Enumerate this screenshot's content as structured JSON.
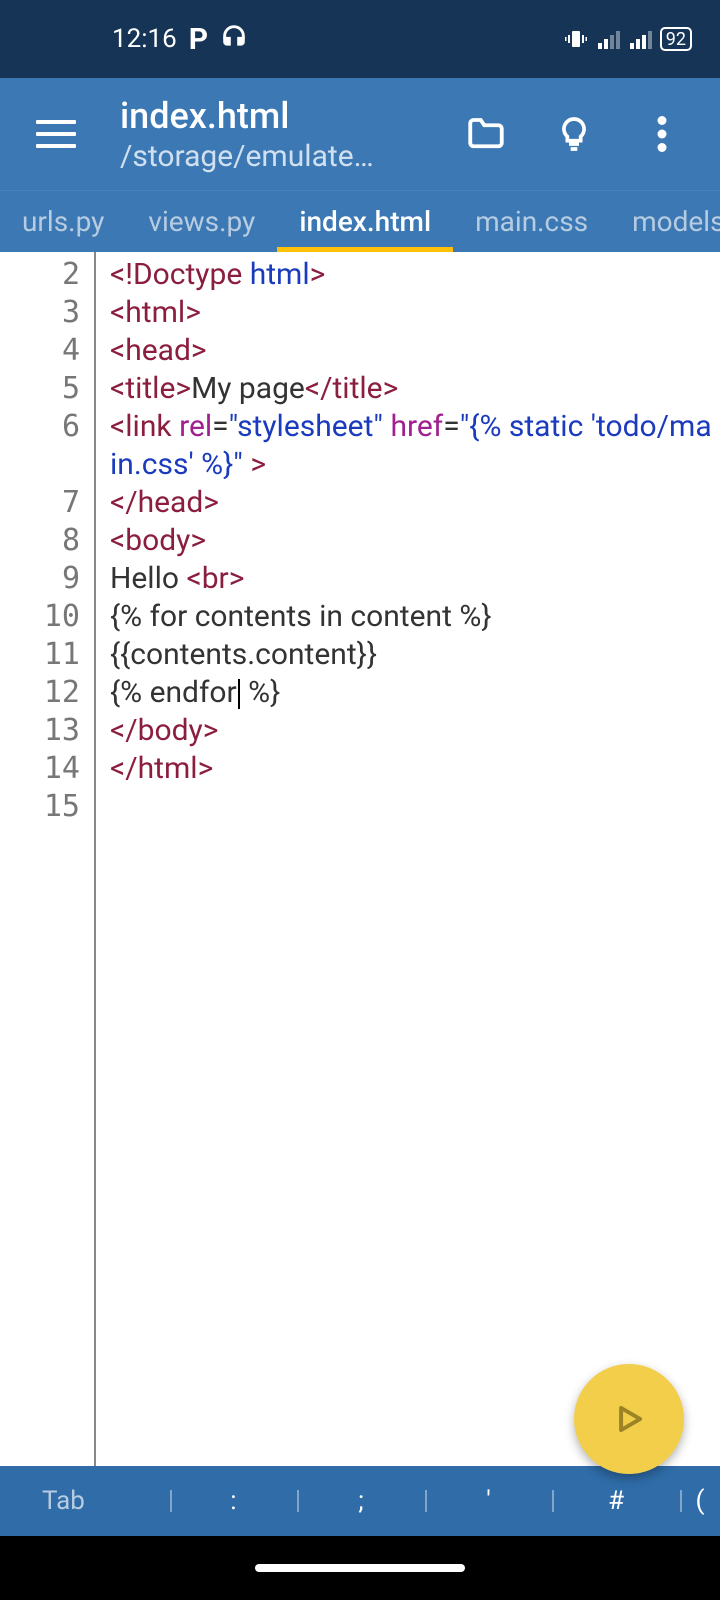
{
  "status": {
    "time": "12:16",
    "battery": "92"
  },
  "header": {
    "title": "index.html",
    "path": "/storage/emulate…"
  },
  "tabs": [
    {
      "label": "urls.py",
      "active": false
    },
    {
      "label": "views.py",
      "active": false
    },
    {
      "label": "index.html",
      "active": true
    },
    {
      "label": "main.css",
      "active": false
    },
    {
      "label": "models.py",
      "active": false
    }
  ],
  "lineNumbers": [
    "2",
    "3",
    "4",
    "5",
    "6",
    "7",
    "8",
    "9",
    "10",
    "11",
    "12",
    "13",
    "14",
    "15"
  ],
  "code": {
    "l2": {
      "a": "<!Doctype ",
      "b": "html",
      "c": ">"
    },
    "l3": {
      "a": "<html>"
    },
    "l4": {
      "a": "<head>"
    },
    "l5": {
      "a": "<title>",
      "b": "My page",
      "c": "</title>"
    },
    "l6": {
      "a": "<link ",
      "b": "rel",
      "c": "=",
      "d": "\"stylesheet\"",
      "e": " ",
      "f": "href",
      "g": "=",
      "h": "\"{% static 'todo/main.css' %}\"",
      "i": " >"
    },
    "l7": {
      "a": "</head>"
    },
    "l8": {
      "a": "<body>"
    },
    "l9": {
      "a": "Hello ",
      "b": "<br>"
    },
    "l10": {
      "a": "{% for contents in content %}"
    },
    "l11": {
      "a": "{{contents.content}}"
    },
    "l12": {
      "a": "{% endfor",
      "b": " %}"
    },
    "l13": {
      "a": "</body>"
    },
    "l14": {
      "a": "</html>"
    }
  },
  "keyrow": {
    "k0": "Tab",
    "k1": ":",
    "k2": ";",
    "k3": "'",
    "k4": "#",
    "k5": "("
  }
}
